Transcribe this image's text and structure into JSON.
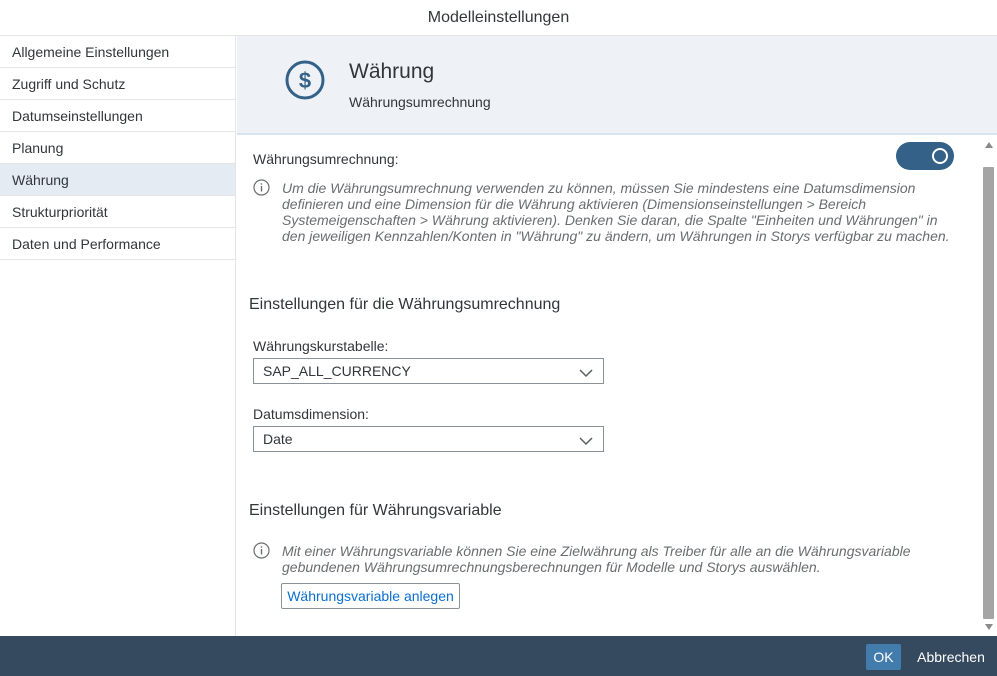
{
  "dialog": {
    "title": "Modelleinstellungen"
  },
  "sidebar": {
    "items": [
      {
        "label": "Allgemeine Einstellungen"
      },
      {
        "label": "Zugriff und Schutz"
      },
      {
        "label": "Datumseinstellungen"
      },
      {
        "label": "Planung"
      },
      {
        "label": "Währung"
      },
      {
        "label": "Strukturpriorität"
      },
      {
        "label": "Daten und Performance"
      }
    ],
    "active": "Währung"
  },
  "header": {
    "icon": "dollar-circle-icon",
    "title": "Währung",
    "subtitle": "Währungsumrechnung"
  },
  "conversion": {
    "label": "Währungsumrechnung:",
    "enabled": true,
    "info": "Um die Währungsumrechnung verwenden zu können, müssen Sie mindestens eine Datumsdimension definieren und eine Dimension für die Währung aktivieren (Dimensionseinstellungen > Bereich Systemeigenschaften > Währung aktivieren). Denken Sie daran, die Spalte \"Einheiten und Währungen\" in den jeweiligen Kennzahlen/Konten in \"Währung\" zu ändern, um Währungen in Storys verfügbar zu machen."
  },
  "conversion_settings": {
    "title": "Einstellungen für die Währungsumrechnung",
    "rate_table_label": "Währungskurstabelle:",
    "rate_table_value": "SAP_ALL_CURRENCY",
    "date_dimension_label": "Datumsdimension:",
    "date_dimension_value": "Date"
  },
  "variable_settings": {
    "title": "Einstellungen für Währungsvariable",
    "info": "Mit einer Währungsvariable können Sie eine Zielwährung als Treiber für alle an die Währungsvariable gebundenen Währungsumrechnungsberechnungen für Modelle und Storys auswählen.",
    "create_button": "Währungsvariable anlegen"
  },
  "footer": {
    "ok_label": "OK",
    "cancel_label": "Abbrechen"
  },
  "colors": {
    "accent": "#346187",
    "footer": "#354a5f",
    "ok": "#427cac",
    "active_item": "#e5ebf3",
    "header_bg": "#eef2f6"
  }
}
